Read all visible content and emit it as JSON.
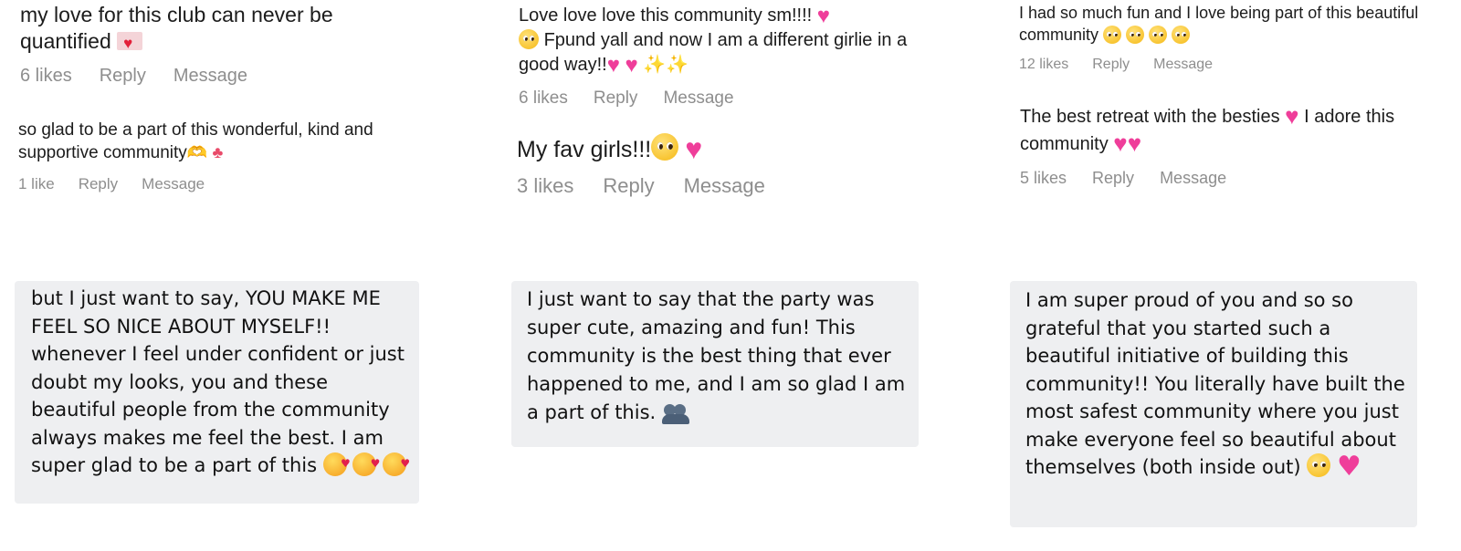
{
  "comments": [
    {
      "text": "my love for this club can never be quantified",
      "likes": "6 likes",
      "reply": "Reply",
      "message": "Message"
    },
    {
      "text": "so glad to be a part of this wonderful, kind and supportive community",
      "likes": "1 like",
      "reply": "Reply",
      "message": "Message"
    },
    {
      "text_a": "Love love love this community sm!!!!",
      "text_b": "Fpund yall and now I am a different girlie in a good way!!",
      "likes": "6 likes",
      "reply": "Reply",
      "message": "Message"
    },
    {
      "text": "My fav girls!!!",
      "likes": "3 likes",
      "reply": "Reply",
      "message": "Message"
    },
    {
      "text": "I had so much fun and I love being part of this beautiful community",
      "likes": "12 likes",
      "reply": "Reply",
      "message": "Message"
    },
    {
      "text_a": "The best retreat with the besties",
      "text_b": "I adore this community",
      "likes": "5 likes",
      "reply": "Reply",
      "message": "Message"
    }
  ],
  "messages": [
    {
      "text": "but I just want to say, YOU MAKE ME FEEL SO NICE ABOUT MYSELF!! whenever I feel under confident or just doubt my looks, you and these beautiful people from the community always makes me feel the best. I am super glad to be a part of this"
    },
    {
      "text": "I just want to say that the party was super cute, amazing and fun! This community is the best thing that ever happened to me, and I am so glad I am a part of this."
    },
    {
      "text": "I am super proud of you and so so grateful that you started such a beautiful initiative of building this community!! You literally have built the most safest community where you just make everyone feel so beautiful about themselves (both inside out)"
    }
  ],
  "icons": [
    "red-heart-icon",
    "heart-hands-icon",
    "tulip-icon",
    "pink-heart-icon",
    "pleading-face-icon",
    "sparkles-icon",
    "smiling-face-with-hearts-icon",
    "people-hugging-icon"
  ],
  "colors": {
    "meta_gray": "#8e8e8e",
    "bubble_bg": "#eeeff1",
    "pink_heart": "#ef3e9a"
  }
}
